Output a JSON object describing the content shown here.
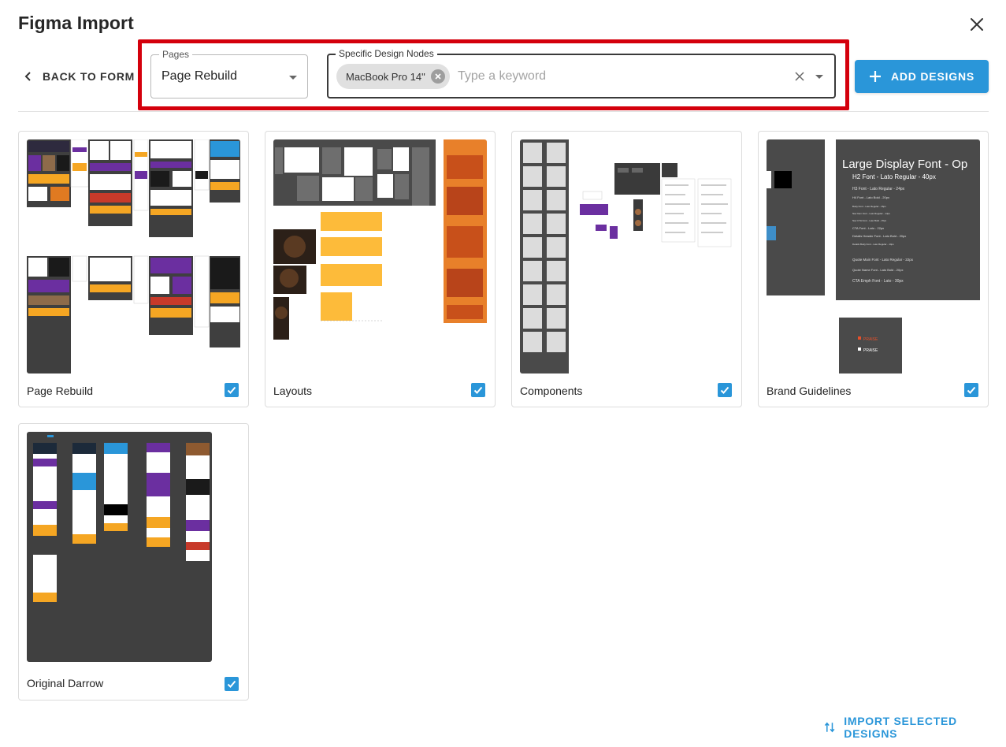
{
  "dialog": {
    "title": "Figma Import",
    "close_icon": "close-icon"
  },
  "toolbar": {
    "back_label": "BACK TO FORM",
    "pages": {
      "label": "Pages",
      "value": "Page Rebuild"
    },
    "nodes": {
      "label": "Specific Design Nodes",
      "chips": [
        "MacBook Pro 14\""
      ],
      "placeholder": "Type a keyword",
      "value": ""
    },
    "add_label": "ADD DESIGNS"
  },
  "cards": [
    {
      "name": "Page Rebuild",
      "checked": true
    },
    {
      "name": "Layouts",
      "checked": true
    },
    {
      "name": "Components",
      "checked": true
    },
    {
      "name": "Brand Guidelines",
      "checked": true
    },
    {
      "name": "Original Darrow",
      "checked": true
    }
  ],
  "brand_preview": {
    "heading": "Large Display Font - Op",
    "h2": "H2 Font - Lato Regular - 40px",
    "lines": [
      "H3 Font - Lato Regular - 24px",
      "H4 Font - Lato Bold - 20px",
      "Body Font - Lato Regular - 16px",
      "Nav Item Font - Lato Regular - 14px",
      "Nav CTA Font - Lato Bold - 15px",
      "CTA Font - Lato - 22px",
      "Details Header Font - Lato Bold - 20px",
      "Details Body Font - Lato Regular - 14px",
      "Quote Main Font - Lato Regular - 22px",
      "Quote Name Font - Lato Bold - 20px",
      "CTA Emph Font - Lato - 30px"
    ],
    "logo_word": "PRAISE"
  },
  "footer": {
    "import_label": "IMPORT SELECTED DESIGNS"
  },
  "colors": {
    "accent": "#2a96d9",
    "highlight": "#d4000c",
    "thumb_dark": "#404040",
    "orange": "#f5a623",
    "purple": "#6b2fa0"
  }
}
